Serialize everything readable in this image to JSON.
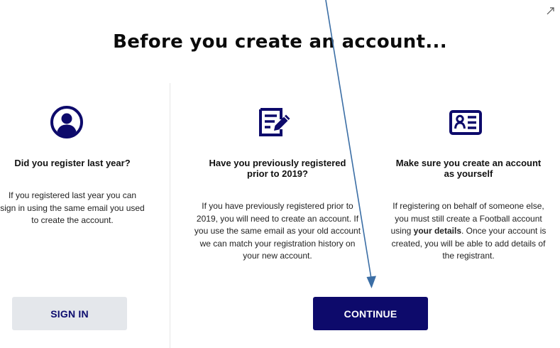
{
  "modal": {
    "title": "Before you create an account...",
    "close_icon": "expand-arrow-icon"
  },
  "columns": [
    {
      "icon": "user-circle-icon",
      "heading": "Did you register last year?",
      "body": "If you registered last year you can sign in using the same email you used to create the account."
    },
    {
      "icon": "edit-document-icon",
      "heading": "Have you previously registered prior to 2019?",
      "body": "If you have previously registered prior to 2019, you will need to create an account. If you use the same email as your old account we can match your registration history on your new account."
    },
    {
      "icon": "id-card-icon",
      "heading": "Make sure you create an account as yourself",
      "body_before": "If registering on behalf of someone else, you must still create a Football account using ",
      "body_bold": "your details",
      "body_after": ". Once your account is created, you will be able to add details of the registrant."
    }
  ],
  "buttons": {
    "sign_in": "SIGN IN",
    "continue": "CONTINUE"
  },
  "colors": {
    "brand_navy": "#0d0a6b",
    "secondary_button_bg": "#e4e7eb",
    "annotation_arrow": "#3b6ea5"
  }
}
